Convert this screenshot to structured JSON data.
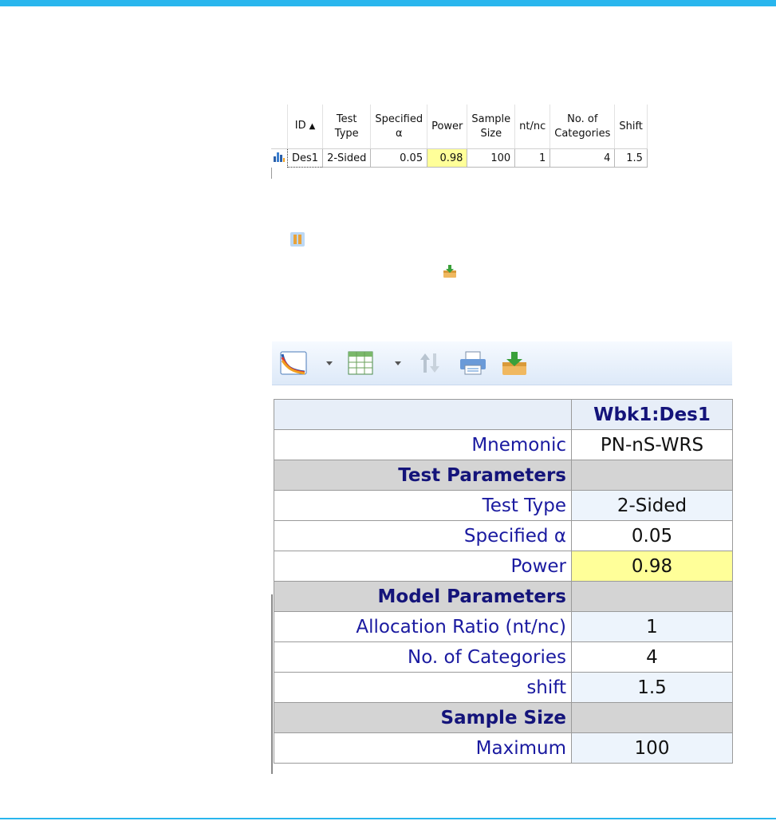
{
  "grid": {
    "headers": [
      {
        "line1": "ID",
        "line2": ""
      },
      {
        "line1": "Test",
        "line2": "Type"
      },
      {
        "line1": "Specified",
        "line2": "α"
      },
      {
        "line1": "Power",
        "line2": ""
      },
      {
        "line1": "Sample",
        "line2": "Size"
      },
      {
        "line1": "nt/nc",
        "line2": ""
      },
      {
        "line1": "No. of",
        "line2": "Categories"
      },
      {
        "line1": "Shift",
        "line2": ""
      }
    ],
    "row": {
      "id": "Des1",
      "test_type": "2-Sided",
      "alpha": "0.05",
      "power": "0.98",
      "sample_size": "100",
      "ratio": "1",
      "categories": "4",
      "shift": "1.5"
    }
  },
  "icons": {
    "row_icon": "design-chart-icon",
    "details_icon": "details-icon",
    "save_icon": "save-to-workbook-icon",
    "toolbar": [
      "plot-icon",
      "table-icon",
      "sort-icon",
      "print-icon",
      "save-icon"
    ]
  },
  "detail": {
    "column_title": "Wbk1:Des1",
    "rows": [
      {
        "label": "Mnemonic",
        "value": "PN-nS-WRS"
      },
      {
        "section": "Test Parameters"
      },
      {
        "label": "Test Type",
        "value": "2-Sided"
      },
      {
        "label": "Specified α",
        "value": "0.05"
      },
      {
        "label": "Power",
        "value": "0.98"
      },
      {
        "section": "Model Parameters"
      },
      {
        "label": "Allocation Ratio (nt/nc)",
        "value": "1"
      },
      {
        "label": "No. of Categories",
        "value": "4"
      },
      {
        "label": "shift",
        "value": "1.5"
      },
      {
        "section": "Sample Size"
      },
      {
        "label": "Maximum",
        "value": "100"
      }
    ]
  },
  "colors": {
    "accent": "#29b6ee",
    "highlight": "#ffff99",
    "header_blue": "#a9cff2",
    "section_gray": "#d4d4d4",
    "label_text": "#1a1aa0"
  }
}
